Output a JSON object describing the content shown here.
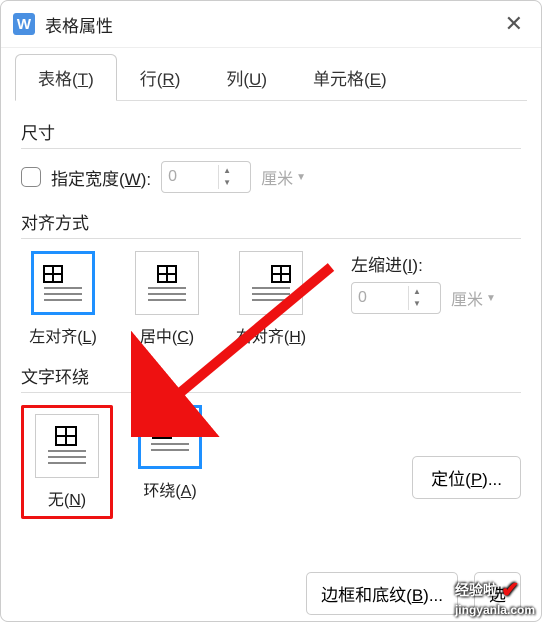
{
  "window": {
    "title": "表格属性",
    "app_icon_letter": "W"
  },
  "tabs": [
    {
      "label": "表格(",
      "key": "T",
      "suffix": ")"
    },
    {
      "label": "行(",
      "key": "R",
      "suffix": ")"
    },
    {
      "label": "列(",
      "key": "U",
      "suffix": ")"
    },
    {
      "label": "单元格(",
      "key": "E",
      "suffix": ")"
    }
  ],
  "size": {
    "section": "尺寸",
    "specify_width_label": "指定宽度(",
    "specify_width_key": "W",
    "specify_width_suffix": "):",
    "value": "0",
    "unit": "厘米"
  },
  "alignment": {
    "section": "对齐方式",
    "options": [
      {
        "label": "左对齐(",
        "key": "L",
        "suffix": ")"
      },
      {
        "label": "居中(",
        "key": "C",
        "suffix": ")"
      },
      {
        "label": "右对齐(",
        "key": "H",
        "suffix": ")"
      }
    ],
    "indent_label": "左缩进(",
    "indent_key": "I",
    "indent_suffix": "):",
    "indent_value": "0",
    "indent_unit": "厘米"
  },
  "wrap": {
    "section": "文字环绕",
    "options": [
      {
        "label": "无(",
        "key": "N",
        "suffix": ")"
      },
      {
        "label": "环绕(",
        "key": "A",
        "suffix": ")"
      }
    ],
    "position_label": "定位(",
    "position_key": "P",
    "position_suffix": ")..."
  },
  "bottom": {
    "border_label": "边框和底纹(",
    "border_key": "B",
    "border_suffix": ")...",
    "opt_label": "选"
  },
  "watermark": {
    "text1": "经验啦",
    "text2": "jingyanla.com"
  }
}
